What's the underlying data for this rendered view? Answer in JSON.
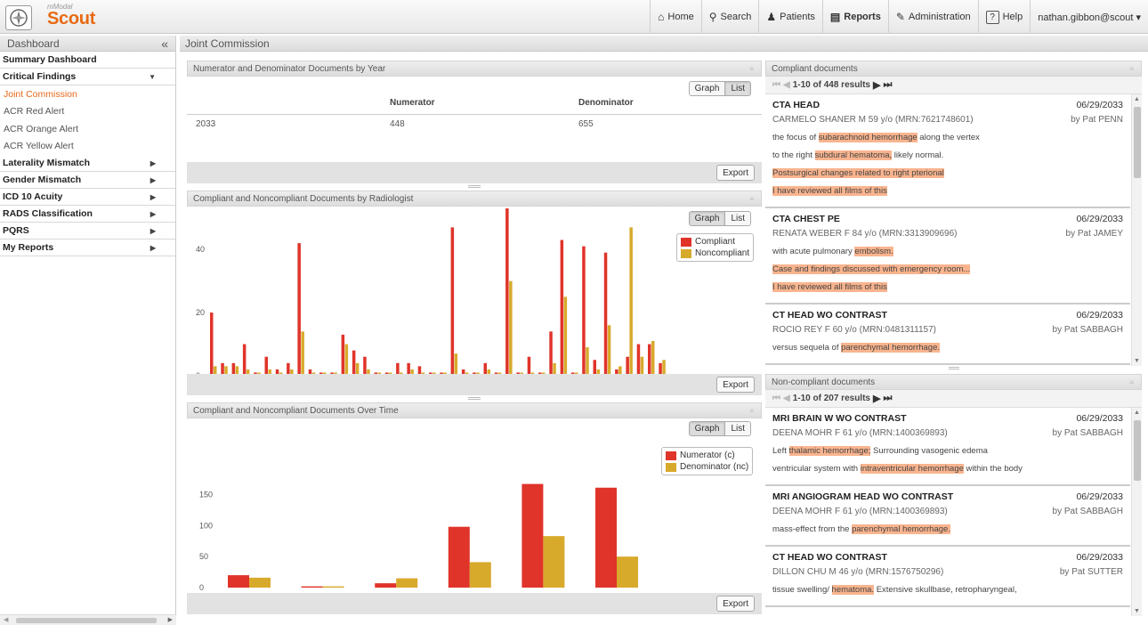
{
  "app": {
    "brand_small": "mModal",
    "brand": "Scout"
  },
  "nav": {
    "home": "Home",
    "search": "Search",
    "patients": "Patients",
    "reports": "Reports",
    "administration": "Administration",
    "help_icon": "?",
    "help": "Help",
    "user": "nathan.gibbon@scout ▾"
  },
  "sidebar": {
    "title": "Dashboard",
    "collapse": "«",
    "items": [
      {
        "label": "Summary Dashboard",
        "arrow": ""
      },
      {
        "label": "Critical Findings",
        "arrow": "▼"
      },
      {
        "label": "Joint Commission",
        "sub": true,
        "active": true
      },
      {
        "label": "ACR Red Alert",
        "sub": true
      },
      {
        "label": "ACR Orange Alert",
        "sub": true
      },
      {
        "label": "ACR Yellow Alert",
        "sub": true
      },
      {
        "label": "Laterality Mismatch",
        "arrow": "▶"
      },
      {
        "label": "Gender Mismatch",
        "arrow": "▶"
      },
      {
        "label": "ICD 10 Acuity",
        "arrow": "▶"
      },
      {
        "label": "RADS Classification",
        "arrow": "▶"
      },
      {
        "label": "PQRS",
        "arrow": "▶"
      },
      {
        "label": "My Reports",
        "arrow": "▶"
      }
    ]
  },
  "main": {
    "title": "Joint Commission"
  },
  "panel1": {
    "title": "Numerator and Denominator Documents by Year",
    "graph": "Graph",
    "list": "List",
    "col_num": "Numerator",
    "col_den": "Denominator",
    "year": "2033",
    "numerator": "448",
    "denominator": "655",
    "export": "Export"
  },
  "panel2": {
    "title": "Compliant and Noncompliant Documents by Radiologist",
    "graph": "Graph",
    "list": "List",
    "export": "Export",
    "legend_a": "Compliant",
    "legend_b": "Noncompliant"
  },
  "panel3": {
    "title": "Compliant and Noncompliant Documents Over Time",
    "graph": "Graph",
    "list": "List",
    "export": "Export",
    "legend_a": "Numerator (c)",
    "legend_b": "Denominator (nc)"
  },
  "colors": {
    "red": "#e0342a",
    "gold": "#d8aa2c",
    "accent": "#e8681a",
    "highlight": "#f9b48e"
  },
  "chart_data": [
    {
      "type": "bar",
      "ylim": [
        0,
        55
      ],
      "yticks": [
        0,
        20,
        40
      ],
      "series": [
        {
          "name": "Compliant",
          "values": [
            20,
            4,
            4,
            10,
            1,
            6,
            2,
            4,
            42,
            2,
            1,
            1,
            13,
            8,
            6,
            1,
            1,
            4,
            4,
            3,
            1,
            1,
            47,
            2,
            1,
            4,
            1,
            53,
            1,
            6,
            1,
            14,
            43,
            1,
            41,
            5,
            39,
            2,
            6,
            10,
            10,
            4
          ]
        },
        {
          "name": "Noncompliant",
          "values": [
            3,
            3,
            3,
            2,
            1,
            2,
            1,
            2,
            14,
            1,
            1,
            1,
            10,
            4,
            2,
            1,
            1,
            1,
            2,
            1,
            1,
            1,
            7,
            1,
            1,
            2,
            1,
            30,
            1,
            1,
            1,
            4,
            25,
            1,
            9,
            2,
            16,
            3,
            47,
            6,
            11,
            5
          ]
        }
      ]
    },
    {
      "type": "bar",
      "ylim": [
        0,
        175
      ],
      "yticks": [
        0,
        50,
        100,
        150
      ],
      "series": [
        {
          "name": "Numerator (c)",
          "values": [
            20,
            2,
            7,
            98,
            167,
            161
          ]
        },
        {
          "name": "Denominator (nc)",
          "values": [
            16,
            2,
            15,
            41,
            83,
            50
          ]
        }
      ]
    }
  ],
  "compliant": {
    "title": "Compliant documents",
    "pager_text": "1-10 of 448 results",
    "docs": [
      {
        "title": "CTA HEAD",
        "date": "06/29/2033",
        "patient": "CARMELO SHANER  M  59 y/o  (MRN:7621748601)",
        "by": "by Pat PENN",
        "lines": [
          [
            [
              "the focus of ",
              false
            ],
            [
              "subarachnoid hemorrhage",
              true
            ],
            [
              " along the vertex",
              false
            ]
          ],
          [
            [
              "to the right ",
              false
            ],
            [
              "subdural hematoma,",
              true
            ],
            [
              " likely normal.",
              false
            ]
          ],
          [
            [
              "Postsurgical changes related to right pterional",
              true
            ]
          ],
          [
            [
              "I have reviewed all films of this",
              true
            ]
          ]
        ]
      },
      {
        "title": "CTA CHEST PE",
        "date": "06/29/2033",
        "patient": "RENATA WEBER  F  84 y/o  (MRN:3313909696)",
        "by": "by Pat JAMEY",
        "lines": [
          [
            [
              "with acute pulmonary ",
              false
            ],
            [
              "embolism.",
              true
            ]
          ],
          [
            [
              "Case and findings discussed with emergency room...",
              true
            ]
          ],
          [
            [
              "I have reviewed all films of this",
              true
            ]
          ]
        ]
      },
      {
        "title": "CT HEAD WO CONTRAST",
        "date": "06/29/2033",
        "patient": "ROCIO REY  F  60 y/o  (MRN:0481311157)",
        "by": "by Pat SABBAGH",
        "lines": [
          [
            [
              "versus sequela of ",
              false
            ],
            [
              "parenchymal hemorrhage.",
              true
            ]
          ]
        ]
      }
    ]
  },
  "noncompliant": {
    "title": "Non-compliant documents",
    "pager_text": "1-10 of 207 results",
    "docs": [
      {
        "title": "MRI BRAIN W WO CONTRAST",
        "date": "06/29/2033",
        "patient": "DEENA MOHR  F  61 y/o  (MRN:1400369893)",
        "by": "by Pat SABBAGH",
        "lines": [
          [
            [
              "Left ",
              false
            ],
            [
              "thalamic hemorrhage;",
              true
            ],
            [
              " Surrounding vasogenic edema",
              false
            ]
          ],
          [
            [
              "ventricular system with ",
              false
            ],
            [
              "intraventricular hemorrhage",
              true
            ],
            [
              " within the body",
              false
            ]
          ]
        ]
      },
      {
        "title": "MRI ANGIOGRAM HEAD WO CONTRAST",
        "date": "06/29/2033",
        "patient": "DEENA MOHR  F  61 y/o  (MRN:1400369893)",
        "by": "by Pat SABBAGH",
        "lines": [
          [
            [
              "mass-effect from the ",
              false
            ],
            [
              "parenchymal hemorrhage.",
              true
            ]
          ]
        ]
      },
      {
        "title": "CT HEAD WO CONTRAST",
        "date": "06/29/2033",
        "patient": "DILLON CHU  M  46 y/o  (MRN:1576750296)",
        "by": "by Pat SUTTER",
        "lines": [
          [
            [
              "tissue swelling/ ",
              false
            ],
            [
              "hematoma.",
              true
            ],
            [
              " Extensive skullbase, retropharyngeal,",
              false
            ]
          ]
        ]
      }
    ]
  }
}
